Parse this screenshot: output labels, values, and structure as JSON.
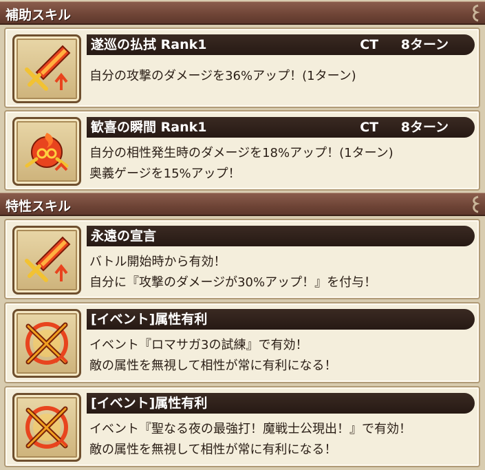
{
  "sections": {
    "support": {
      "title": "補助スキル"
    },
    "trait": {
      "title": "特性スキル"
    }
  },
  "skills": [
    {
      "name": "遂巡の払拭 Rank1",
      "ct": "CT 8ターン",
      "lines": [
        "自分の攻撃のダメージを36%アップ！(1ターン)"
      ],
      "icon": "sword-up-icon"
    },
    {
      "name": "歓喜の瞬間 Rank1",
      "ct": "CT 8ターン",
      "lines": [
        "自分の相性発生時のダメージを18%アップ！(1ターン)",
        "奥義ゲージを15%アップ！"
      ],
      "icon": "flame-crest-icon"
    },
    {
      "name": "永遠の宣言",
      "lines": [
        "バトル開始時から有効！",
        "自分に『攻撃のダメージが30%アップ！』を付与！"
      ],
      "icon": "sword-up-icon"
    },
    {
      "name": "[イベント]属性有利",
      "lines": [
        "イベント『ロマサガ3の試練』で有効！",
        "敵の属性を無視して相性が常に有利になる！"
      ],
      "icon": "attribute-advantage-icon"
    },
    {
      "name": "[イベント]属性有利",
      "lines": [
        "イベント『聖なる夜の最強打！魔戦士公現出！』で有効！",
        "敵の属性を無視して相性が常に有利になる！"
      ],
      "icon": "attribute-advantage-icon"
    }
  ],
  "colors": {
    "header": "#6e4436",
    "card": "#f4eedc",
    "namebar": "#261914",
    "accent": "#e8441e"
  }
}
